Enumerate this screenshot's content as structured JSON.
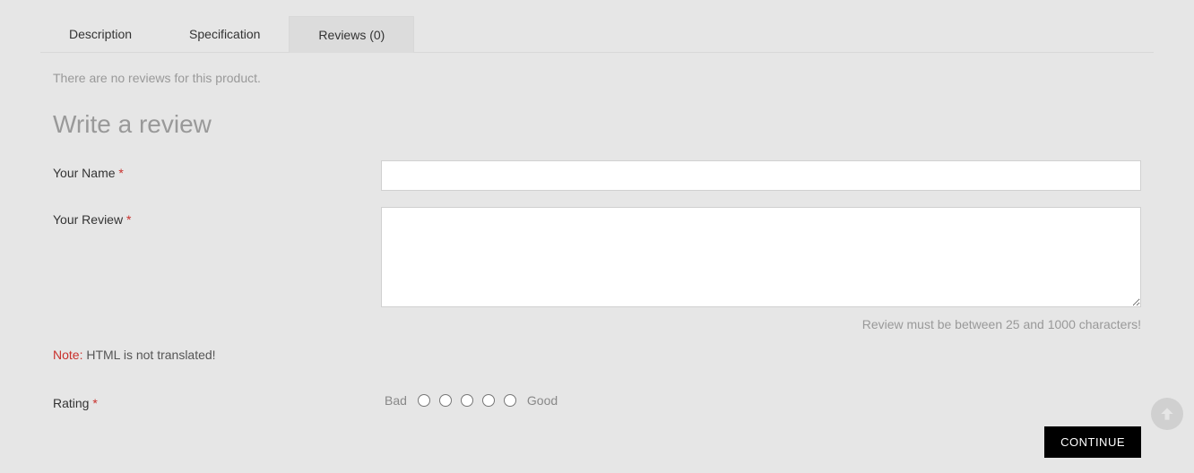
{
  "tabs": {
    "description": "Description",
    "specification": "Specification",
    "reviews": "Reviews (0)"
  },
  "reviews": {
    "empty_message": "There are no reviews for this product.",
    "section_title": "Write a review",
    "labels": {
      "your_name": "Your Name",
      "your_review": "Your Review",
      "rating": "Rating"
    },
    "help_text": "Review must be between 25 and 1000 characters!",
    "note_label": "Note:",
    "note_text": " HTML is not translated!",
    "rating_bad": "Bad",
    "rating_good": "Good",
    "continue_button": "CONTINUE",
    "required_mark": "*"
  }
}
